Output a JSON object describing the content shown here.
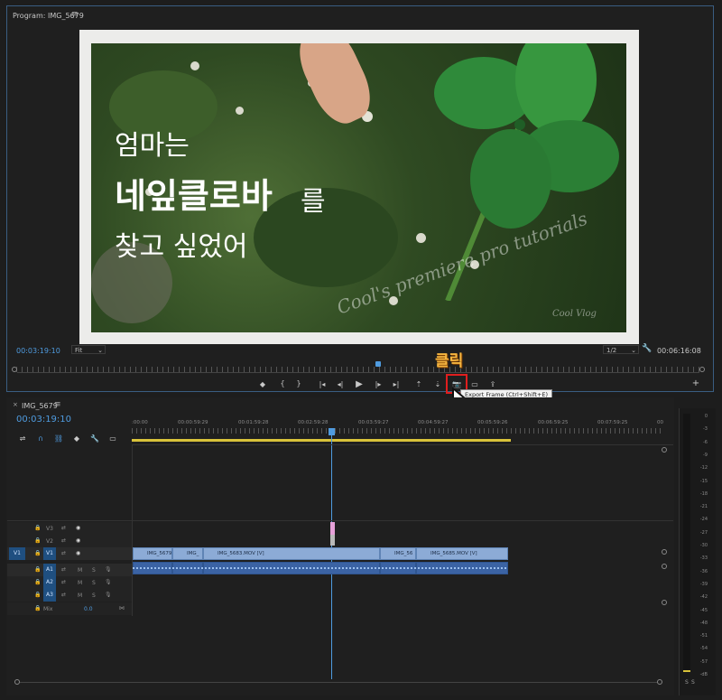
{
  "monitor": {
    "title": "Program: IMG_5679",
    "menu_icon": "hamburger-menu-icon",
    "current_time": "00:03:19:10",
    "fit_label": "Fit",
    "resolution": "1/2",
    "duration": "00:06:16:08"
  },
  "overlay": {
    "line1": "엄마는",
    "line2a": "네잎클로바",
    "line2b": "를",
    "line3": "찾고 싶었어",
    "watermark": "Cool's premiere pro tutorials",
    "watermark_sub": "Cool Vlog",
    "annotation": "클릭"
  },
  "tooltip": "Export Frame (Ctrl+Shift+E)",
  "transport": {
    "icons": [
      "marker-icon",
      "mark-in-icon",
      "mark-out-icon",
      "go-to-in-icon",
      "step-back-icon",
      "play-icon",
      "step-forward-icon",
      "go-to-out-icon",
      "lift-icon",
      "extract-icon",
      "export-frame-icon",
      "comparison-view-icon",
      "export-icon"
    ],
    "add_icon": "plus-icon"
  },
  "timeline": {
    "title": "IMG_5679",
    "current_time": "00:03:19:10",
    "ruler": [
      ":00:00",
      "00:00:59:29",
      "00:01:59:28",
      "00:02:59:28",
      "00:03:59:27",
      "00:04:59:27",
      "00:05:59:26",
      "00:06:59:25",
      "00:07:59:25",
      "00"
    ],
    "tracks": [
      {
        "id": "v3",
        "label": "V3"
      },
      {
        "id": "v2",
        "label": "V2"
      },
      {
        "id": "v1",
        "label": "V1",
        "source": "V1"
      },
      {
        "id": "a1",
        "label": "A1",
        "m": "M",
        "s": "S"
      },
      {
        "id": "a2",
        "label": "A2",
        "m": "M",
        "s": "S"
      },
      {
        "id": "a3",
        "label": "A3",
        "m": "M",
        "s": "S"
      },
      {
        "id": "mix",
        "label": "Mix",
        "value": "0.0"
      }
    ],
    "clips": [
      {
        "label": "IMG_5679"
      },
      {
        "label": "IMG_"
      },
      {
        "label": "IMG_5683.MOV [V]"
      },
      {
        "label": "IMG_56"
      },
      {
        "label": "IMG_5685.MOV [V]"
      }
    ]
  },
  "meter": {
    "labels": [
      "0",
      "-3",
      "-6",
      "-9",
      "-12",
      "-15",
      "-18",
      "-21",
      "-24",
      "-27",
      "-30",
      "-33",
      "-36",
      "-39",
      "-42",
      "-45",
      "-48",
      "-51",
      "-54",
      "-57",
      "-dB"
    ],
    "solo_labels": [
      "S",
      "S"
    ]
  },
  "colors": {
    "accent_blue": "#4f9bdf",
    "clip_video": "#8cabd6",
    "clip_audio": "#3b63a4",
    "work_area": "#d8c23a",
    "annotation_red": "#e01e1e",
    "annotation_text": "#f5b540"
  }
}
